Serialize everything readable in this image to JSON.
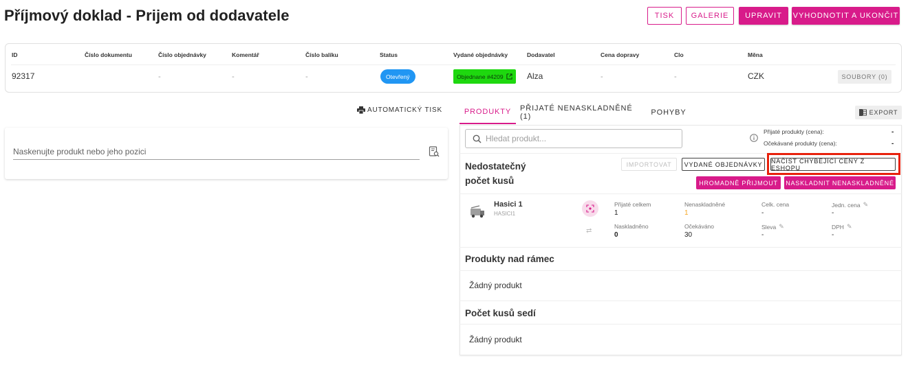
{
  "page_title": "Příjmový doklad - Prijem od dodavatele",
  "header_buttons": {
    "print": "TISK",
    "gallery": "GALERIE",
    "edit": "UPRAVIT",
    "evaluate": "VYHODNOTIT A UKONČIT"
  },
  "info": {
    "headers": {
      "id": "ID",
      "doc_number": "Číslo dokumentu",
      "order_number": "Číslo objednávky",
      "comment": "Komentář",
      "package_number": "Číslo balíku",
      "status": "Status",
      "issued_orders": "Vydané objednávky",
      "supplier": "Dodavatel",
      "shipping_price": "Cena dopravy",
      "duty": "Clo",
      "currency": "Měna"
    },
    "values": {
      "id": "92317",
      "order_number": "-",
      "comment": "-",
      "package_number": "-",
      "status": "Otevřený",
      "issued_order": "Objednane #4209",
      "supplier": "Alza",
      "shipping_price": "-",
      "duty": "-",
      "currency": "CZK"
    },
    "files_button": "SOUBORY (0)"
  },
  "auto_print": "AUTOMATICKÝ TISK",
  "scan": {
    "label": "Naskenujte produkt nebo jeho pozici"
  },
  "tabs": {
    "products": "PRODUKTY",
    "received": "PŘIJATÉ NENASKLADNĚNÉ (1)",
    "movements": "POHYBY"
  },
  "export_button": "EXPORT",
  "search": {
    "placeholder": "Hledat produkt..."
  },
  "summary": {
    "received_label": "Přijaté produkty (cena):",
    "received_value": "-",
    "expected_label": "Očekávané produkty (cena):",
    "expected_value": "-"
  },
  "insufficient": {
    "title_line1": "Nedostatečný",
    "title_line2": "počet kusů",
    "import": "IMPORTOVAT",
    "issued_orders": "VYDANÉ OBJEDNÁVKY",
    "load_prices": "NAČÍST CHYBĚJÍCÍ CENY Z ESHOPU",
    "bulk_receive": "HROMADNĚ PŘIJMOUT",
    "stock_unstocked": "NASKLADNIT NENASKLADNĚNÉ"
  },
  "product": {
    "name": "Hasici 1",
    "code": "HASICI1",
    "received_total_label": "Přijaté celkem",
    "received_total": "1",
    "unstocked_label": "Nenaskladněné",
    "unstocked": "1",
    "total_price_label": "Celk. cena",
    "total_price": "-",
    "unit_price_label": "Jedn. cena",
    "unit_price": "-",
    "stocked_label": "Naskladněno",
    "stocked": "0",
    "expected_label": "Očekáváno",
    "expected": "30",
    "discount_label": "Sleva",
    "discount": "-",
    "vat_label": "DPH",
    "vat": "-"
  },
  "over_frame": {
    "title": "Produkty nad rámec",
    "empty": "Žádný produkt"
  },
  "count_matches": {
    "title": "Počet kusů sedí",
    "empty": "Žádný produkt"
  },
  "colors": {
    "accent": "#d81b8a",
    "status_blue": "#2196f3",
    "order_green": "#1ed80f",
    "highlight_red": "#e8210c",
    "unstocked_orange": "#f5a623"
  }
}
